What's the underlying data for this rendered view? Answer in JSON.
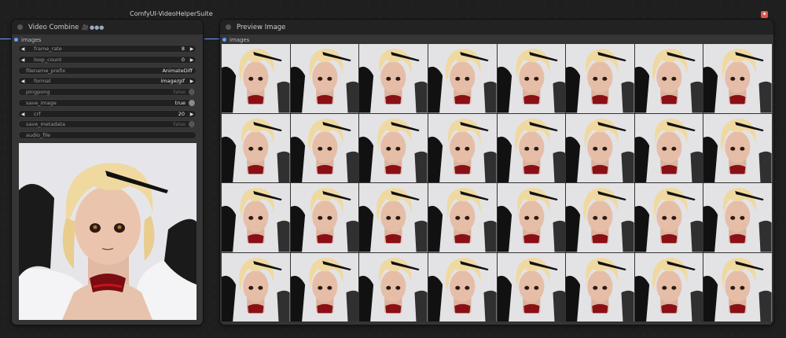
{
  "group": {
    "title": "ComfyUI-VideoHelperSuite"
  },
  "video_combine": {
    "title": "Video Combine",
    "badges": [
      "🎥",
      "●●●"
    ],
    "input_label": "images",
    "widgets": [
      {
        "name": "frame_rate",
        "value": "8",
        "kind": "number"
      },
      {
        "name": "loop_count",
        "value": "0",
        "kind": "number"
      },
      {
        "name": "filename_prefix",
        "value": "AnimateDiff",
        "kind": "text"
      },
      {
        "name": "format",
        "value": "image/gif",
        "kind": "combo"
      },
      {
        "name": "pingpong",
        "value": "false",
        "kind": "toggle"
      },
      {
        "name": "save_image",
        "value": "true",
        "kind": "toggle"
      },
      {
        "name": "crf",
        "value": "20",
        "kind": "number"
      },
      {
        "name": "save_metadata",
        "value": "false",
        "kind": "toggle"
      },
      {
        "name": "audio_file",
        "value": "",
        "kind": "text"
      }
    ]
  },
  "preview_image": {
    "title": "Preview Image",
    "input_label": "images",
    "grid": {
      "columns": 8,
      "rows": 4
    }
  },
  "colors": {
    "link": "#6aa0ff",
    "node_bg": "#353535",
    "title_bg": "#222222",
    "hair": "#f0d9a0",
    "feather": "#111111"
  }
}
